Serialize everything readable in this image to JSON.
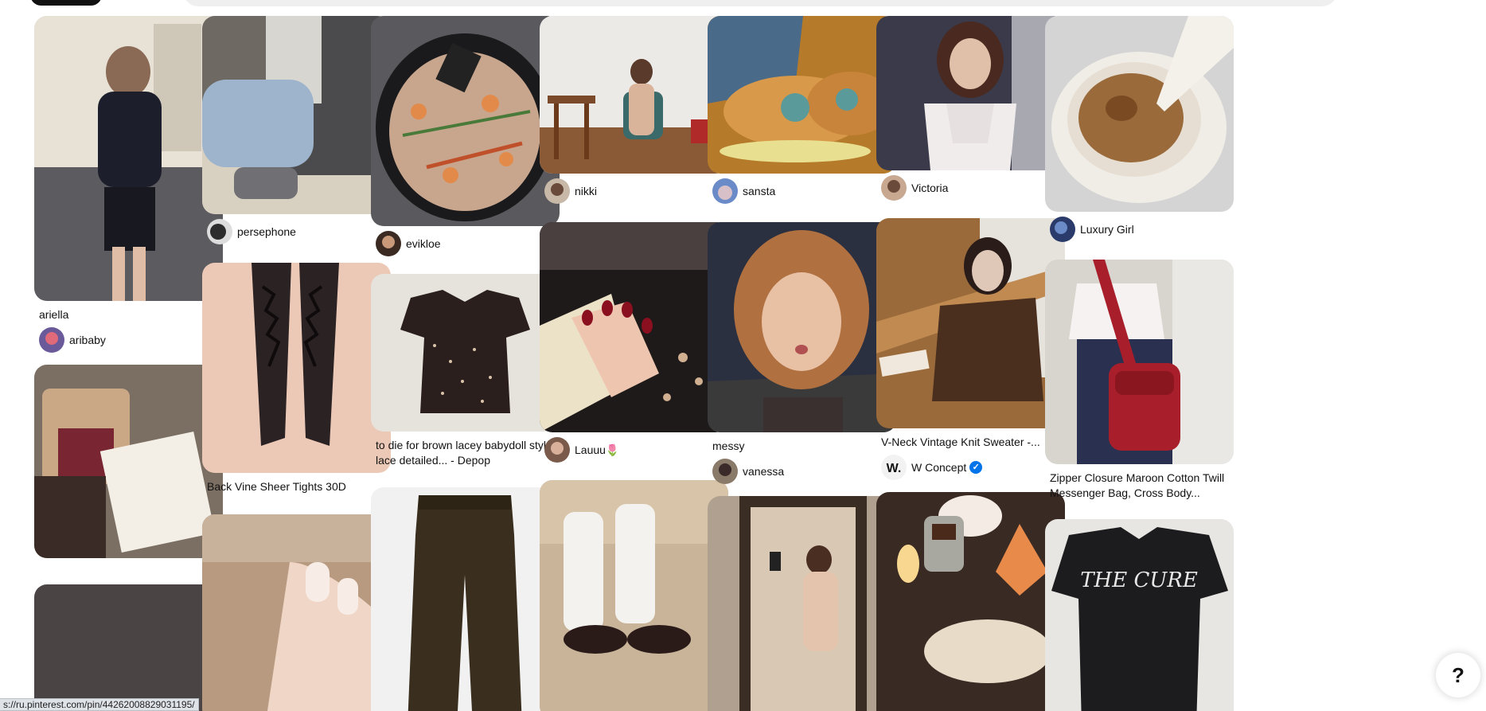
{
  "colors": {
    "background": "#ffffff",
    "accent": "#111111",
    "verified": "#0074e8"
  },
  "help_button": {
    "label": "?",
    "icon": "question-mark-icon"
  },
  "status_bar": {
    "url": "s://ru.pinterest.com/pin/44262008829031195/"
  },
  "pins": [
    {
      "title": "ariella",
      "user": "aribaby"
    },
    {
      "title": "",
      "user": ""
    },
    {
      "title": "",
      "user": ""
    },
    {
      "title": "",
      "user": "persephone"
    },
    {
      "title": "Back Vine Sheer Tights 30D",
      "user": ""
    },
    {
      "title": "",
      "user": ""
    },
    {
      "title": "",
      "user": "evikloe"
    },
    {
      "title": "to die for brown lacey babydoll style lace detailed... - Depop",
      "user": ""
    },
    {
      "title": "",
      "user": ""
    },
    {
      "title": "",
      "user": "nikki"
    },
    {
      "title": "",
      "user": "Lauuu🌷"
    },
    {
      "title": "",
      "user": ""
    },
    {
      "title": "",
      "user": "sansta"
    },
    {
      "title": "messy",
      "user": "vanessa"
    },
    {
      "title": "",
      "user": ""
    },
    {
      "title": "",
      "user": "Victoria"
    },
    {
      "title": "V-Neck Vintage Knit Sweater -...",
      "user": "W Concept",
      "verified": true
    },
    {
      "title": "",
      "user": ""
    },
    {
      "title": "",
      "user": "Luxury Girl"
    },
    {
      "title": "Zipper Closure Maroon Cotton Twill Messenger Bag, Cross Body...",
      "user": ""
    },
    {
      "title": "",
      "user": ""
    }
  ]
}
